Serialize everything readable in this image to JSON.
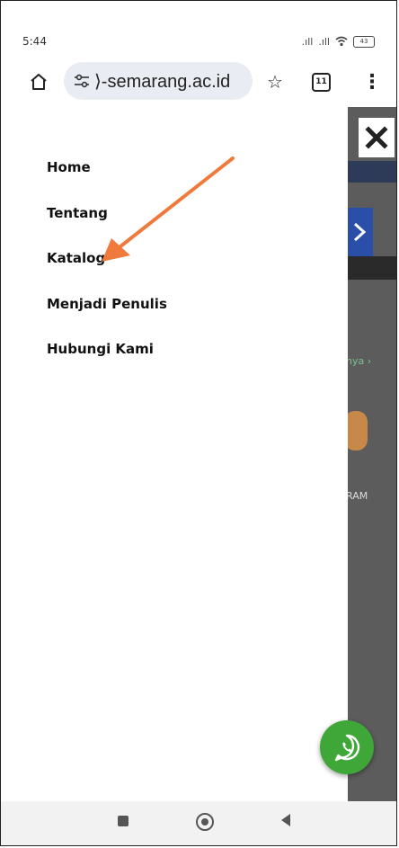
{
  "status_bar": {
    "time": "5:44",
    "signal_1": ".ıll",
    "signal_2": ".ıll",
    "wifi": "wifi-icon",
    "battery_level": "43"
  },
  "browser": {
    "url": "⟩-semarang.ac.id",
    "tab_count": "11",
    "icons": [
      "home-icon",
      "site-settings-icon",
      "bookmark-star-icon",
      "tabs-icon",
      "menu-kebab-icon"
    ]
  },
  "menu": {
    "items": [
      {
        "label": "Home"
      },
      {
        "label": "Tentang"
      },
      {
        "label": "Katalog"
      },
      {
        "label": "Menjadi Penulis"
      },
      {
        "label": "Hubungi Kami"
      }
    ]
  },
  "background_page": {
    "text_1": "nya ›",
    "text_2": "RAM"
  },
  "annotation": {
    "arrow_color": "#f07a3c"
  },
  "colors": {
    "overlay": "#5c5c5c",
    "whatsapp": "#3fa638",
    "url_pill": "#e9ecf2"
  }
}
